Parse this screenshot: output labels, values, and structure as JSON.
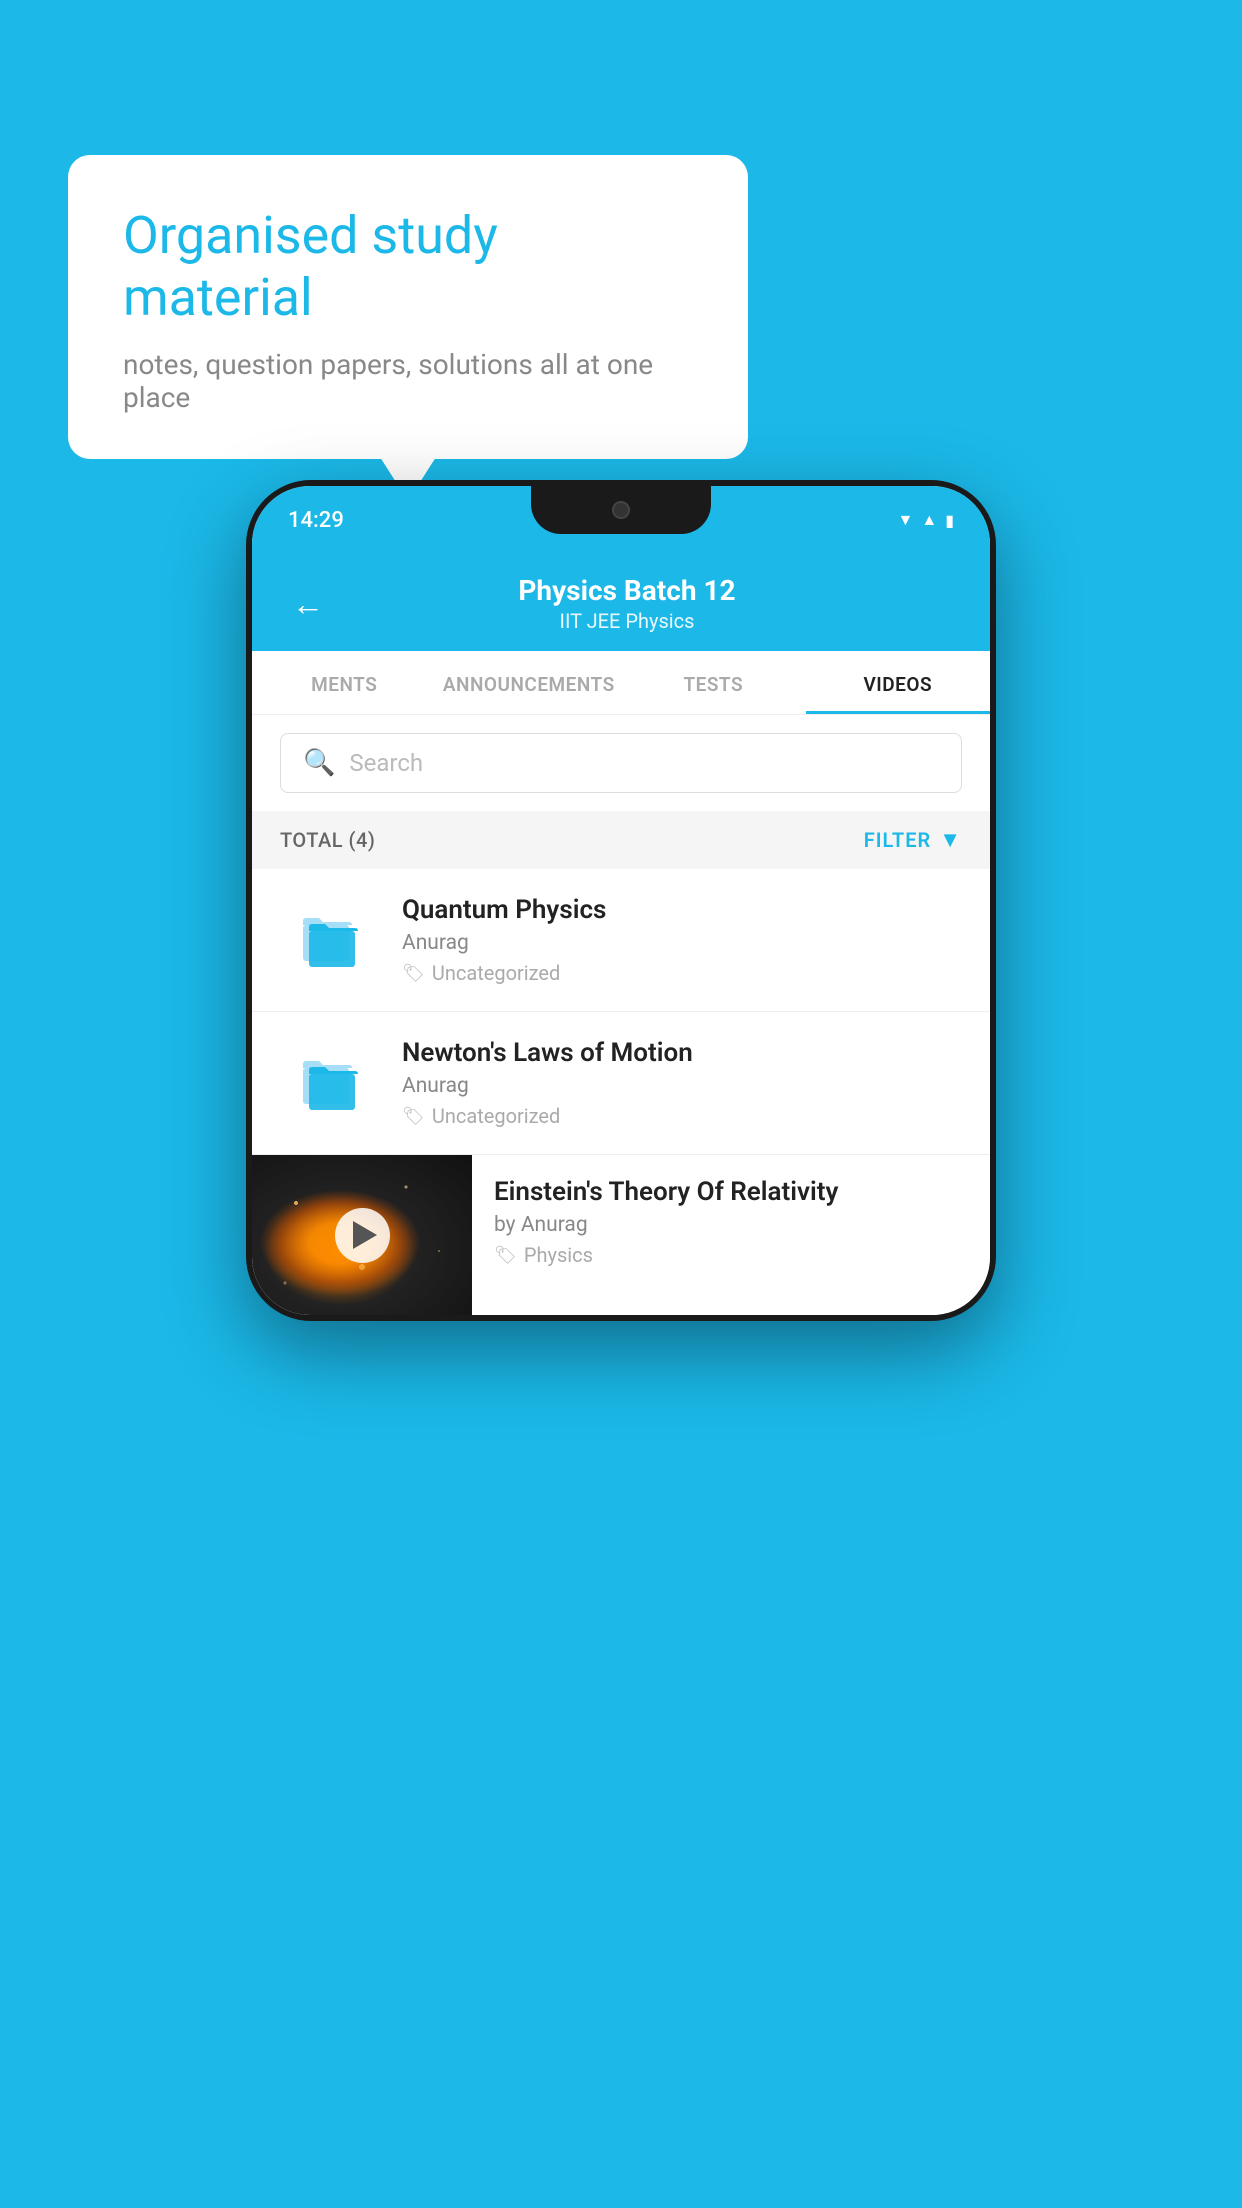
{
  "bubble": {
    "title": "Organised study material",
    "subtitle": "notes, question papers, solutions all at one place"
  },
  "status_bar": {
    "time": "14:29",
    "wifi": "wifi",
    "signal": "signal",
    "battery": "battery"
  },
  "header": {
    "back_label": "←",
    "title": "Physics Batch 12",
    "subtitle": "IIT JEE   Physics"
  },
  "tabs": [
    {
      "label": "MENTS",
      "active": false
    },
    {
      "label": "ANNOUNCEMENTS",
      "active": false
    },
    {
      "label": "TESTS",
      "active": false
    },
    {
      "label": "VIDEOS",
      "active": true
    }
  ],
  "search": {
    "placeholder": "Search"
  },
  "filter_bar": {
    "total_label": "TOTAL (4)",
    "filter_label": "FILTER"
  },
  "videos": [
    {
      "title": "Quantum Physics",
      "author": "Anurag",
      "tag": "Uncategorized",
      "type": "folder"
    },
    {
      "title": "Newton's Laws of Motion",
      "author": "Anurag",
      "tag": "Uncategorized",
      "type": "folder"
    },
    {
      "title": "Einstein's Theory Of Relativity",
      "author": "by Anurag",
      "tag": "Physics",
      "type": "video"
    }
  ],
  "colors": {
    "primary": "#1bb8e8",
    "text_dark": "#222222",
    "text_gray": "#888888",
    "text_light": "#aaaaaa"
  }
}
